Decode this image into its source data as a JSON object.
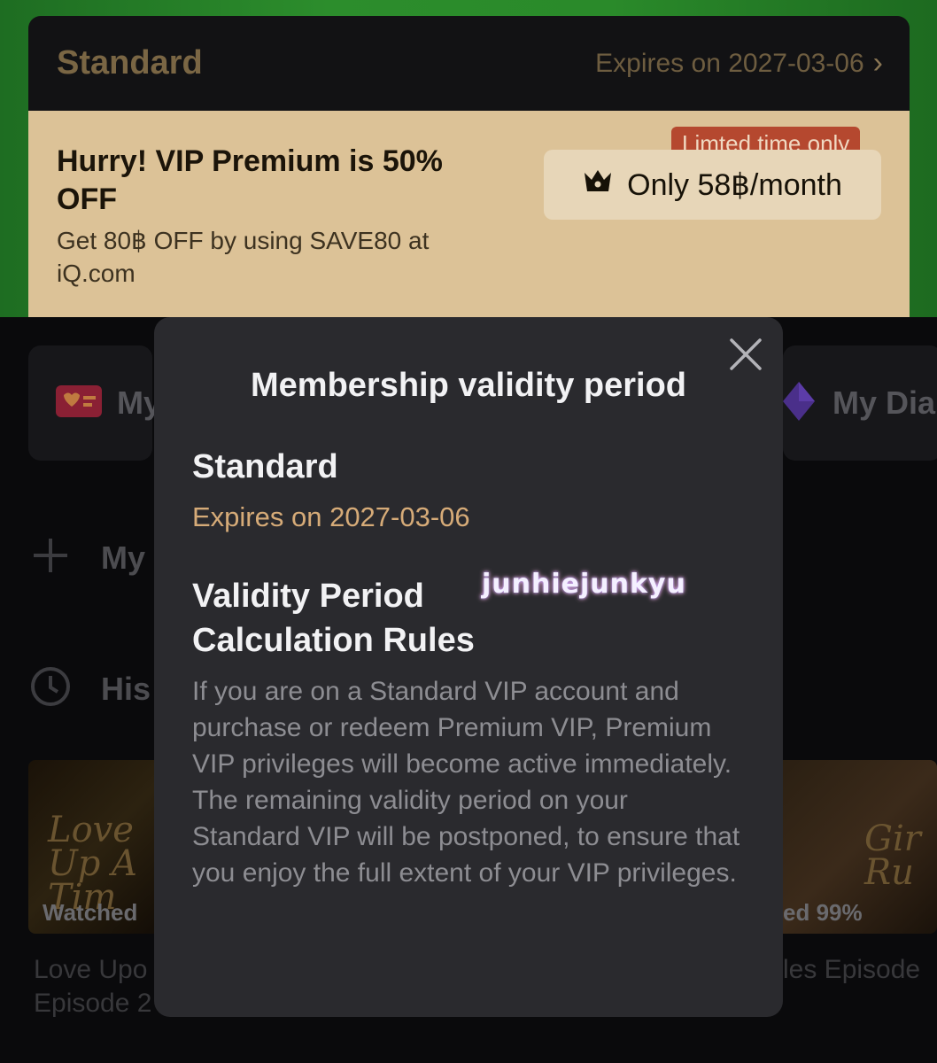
{
  "vip_card": {
    "tier": "Standard",
    "expiry": "Expires on 2027-03-06",
    "promo_title": "Hurry! VIP Premium is 50% OFF",
    "promo_subtitle": "Get 80฿ OFF by using SAVE80 at iQ.com",
    "limited_tag": "Limted time only",
    "price_button": "Only 58฿/month"
  },
  "quick_cards": {
    "left_label": "My",
    "right_label": "My Dia"
  },
  "rows": {
    "add_label": "My",
    "history_label": "His"
  },
  "history": {
    "left_title_art": "Love Up A Tim",
    "left_progress": "Watched",
    "left_caption": "Love Upo Episode 2",
    "right_title_art": "Gir Ru",
    "right_progress": "ed 99%",
    "right_caption": "les Episode"
  },
  "modal": {
    "title": "Membership validity period",
    "tier": "Standard",
    "expiry": "Expires on 2027-03-06",
    "rules_title": "Validity Period Calculation Rules",
    "rules_body": "If you are on a Standard VIP account and purchase or redeem Premium VIP, Premium VIP privileges will become active immediately. The remaining validity period on your Standard VIP will be postponed, to ensure that you enjoy the full extent of your VIP privileges.",
    "watermark": "junhiejunkyu"
  },
  "colors": {
    "accent_gold": "#d6ab78",
    "modal_bg": "#2a2a2e",
    "promo_bg": "#dcc297",
    "limited_tag_bg": "#b5482f"
  }
}
